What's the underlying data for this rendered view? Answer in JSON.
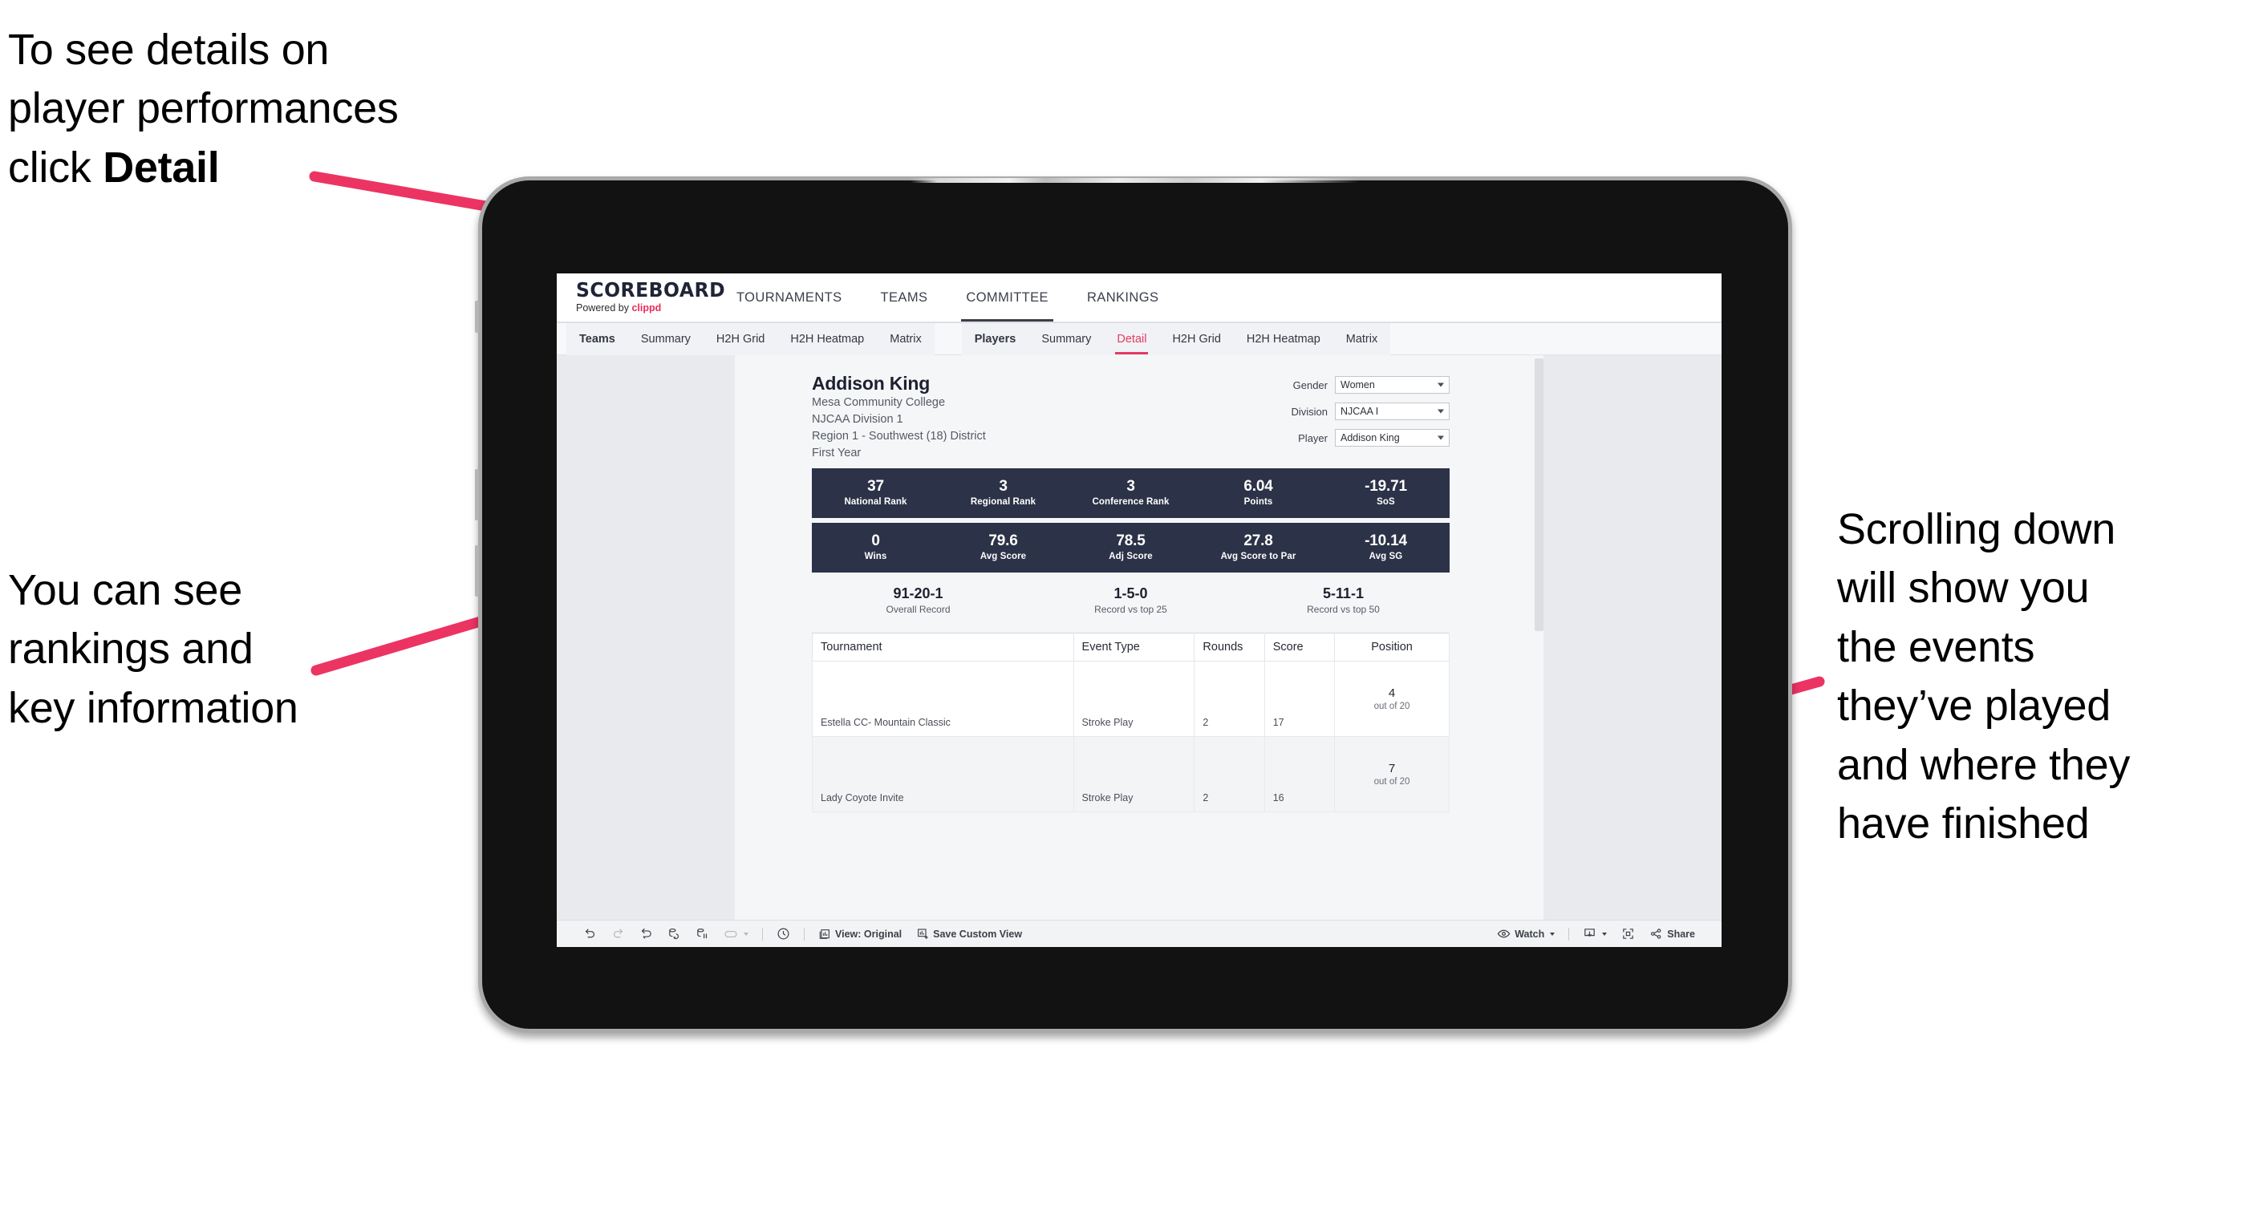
{
  "annotations": {
    "top_left": "To see details on\nplayer performances\nclick ",
    "top_left_bold": "Detail",
    "bottom_left": "You can see\nrankings and\nkey information",
    "right": "Scrolling down\nwill show you\nthe events\nthey’ve played\nand where they\nhave finished",
    "arrow_color": "#ec3463"
  },
  "app": {
    "brand": {
      "title": "SCOREBOARD",
      "powered_prefix": "Powered by ",
      "powered_name": "clippd"
    },
    "topnav": [
      {
        "label": "TOURNAMENTS",
        "active": false
      },
      {
        "label": "TEAMS",
        "active": false
      },
      {
        "label": "COMMITTEE",
        "active": true
      },
      {
        "label": "RANKINGS",
        "active": false
      }
    ],
    "subnav_left": [
      {
        "label": "Teams",
        "bold": true
      },
      {
        "label": "Summary",
        "bold": false
      },
      {
        "label": "H2H Grid",
        "bold": false
      },
      {
        "label": "H2H Heatmap",
        "bold": false
      },
      {
        "label": "Matrix",
        "bold": false
      }
    ],
    "subnav_right": [
      {
        "label": "Players",
        "bold": true
      },
      {
        "label": "Summary",
        "bold": false
      },
      {
        "label": "Detail",
        "bold": false,
        "active": true
      },
      {
        "label": "H2H Grid",
        "bold": false
      },
      {
        "label": "H2H Heatmap",
        "bold": false
      },
      {
        "label": "Matrix",
        "bold": false
      }
    ]
  },
  "player": {
    "name": "Addison King",
    "school": "Mesa Community College",
    "division": "NJCAA Division 1",
    "region": "Region 1 - Southwest (18) District",
    "year": "First Year"
  },
  "filters": [
    {
      "label": "Gender",
      "value": "Women"
    },
    {
      "label": "Division",
      "value": "NJCAA I"
    },
    {
      "label": "Player",
      "value": "Addison King"
    }
  ],
  "stats_row1": [
    {
      "value": "37",
      "label": "National Rank"
    },
    {
      "value": "3",
      "label": "Regional Rank"
    },
    {
      "value": "3",
      "label": "Conference Rank"
    },
    {
      "value": "6.04",
      "label": "Points"
    },
    {
      "value": "-19.71",
      "label": "SoS"
    }
  ],
  "stats_row2": [
    {
      "value": "0",
      "label": "Wins"
    },
    {
      "value": "79.6",
      "label": "Avg Score"
    },
    {
      "value": "78.5",
      "label": "Adj Score"
    },
    {
      "value": "27.8",
      "label": "Avg Score to Par"
    },
    {
      "value": "-10.14",
      "label": "Avg SG"
    }
  ],
  "records": [
    {
      "value": "91-20-1",
      "label": "Overall Record"
    },
    {
      "value": "1-5-0",
      "label": "Record vs top 25"
    },
    {
      "value": "5-11-1",
      "label": "Record vs top 50"
    }
  ],
  "events_table": {
    "columns": [
      "Tournament",
      "Event Type",
      "Rounds",
      "Score",
      "Position"
    ],
    "rows": [
      {
        "tournament": "Estella CC- Mountain Classic",
        "event_type": "Stroke Play",
        "rounds": "2",
        "score": "17",
        "position": "4",
        "position_sub": "out of 20"
      },
      {
        "tournament": "Lady Coyote Invite",
        "event_type": "Stroke Play",
        "rounds": "2",
        "score": "16",
        "position": "7",
        "position_sub": "out of 20"
      }
    ]
  },
  "toolbar": {
    "view_label": "View: Original",
    "save_label": "Save Custom View",
    "watch_label": "Watch",
    "share_label": "Share"
  }
}
